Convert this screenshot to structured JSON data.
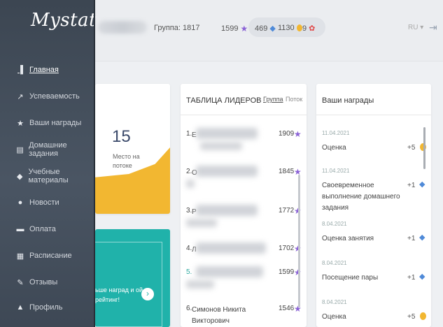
{
  "app": {
    "logo": "Mystat",
    "collapse_glyph": "‹"
  },
  "header": {
    "group": "Группа: 1817",
    "stars": "1599",
    "gems": "469",
    "coins": "1130",
    "badges": "9",
    "lang": "RU ▾"
  },
  "sidebar": {
    "items": [
      {
        "label": "Главная",
        "icon": "chart-icon",
        "glyph": "▐"
      },
      {
        "label": "Успеваемость",
        "icon": "trend-icon",
        "glyph": "↗"
      },
      {
        "label": "Ваши награды",
        "icon": "star-icon",
        "glyph": "★"
      },
      {
        "label": "Домашние задания",
        "icon": "homework-icon",
        "glyph": "▤"
      },
      {
        "label": "Учебные материалы",
        "icon": "materials-icon",
        "glyph": "◆"
      },
      {
        "label": "Новости",
        "icon": "news-icon",
        "glyph": "●"
      },
      {
        "label": "Оплата",
        "icon": "payment-icon",
        "glyph": "▬"
      },
      {
        "label": "Расписание",
        "icon": "calendar-icon",
        "glyph": "▦"
      },
      {
        "label": "Отзывы",
        "icon": "review-icon",
        "glyph": "✎"
      },
      {
        "label": "Профиль",
        "icon": "user-icon",
        "glyph": "▲"
      }
    ]
  },
  "rank": {
    "value": "15",
    "text": "Место на потоке"
  },
  "promo": {
    "text": "ьше наград и ой рейтинг!",
    "arrow": "›"
  },
  "leaders": {
    "title": "ТАБЛИЦА ЛИДЕРОВ",
    "tab_group": "Группа",
    "tab_stream": "Поток",
    "rows": [
      {
        "pos": "1.",
        "name": "Е",
        "points": "1909"
      },
      {
        "pos": "2.",
        "name": "О",
        "points": "1845"
      },
      {
        "pos": "3.",
        "name": "Р",
        "points": "1772"
      },
      {
        "pos": "4.",
        "name": "Л",
        "points": "1702"
      },
      {
        "pos": "5.",
        "name": "",
        "points": "1599"
      },
      {
        "pos": "6.",
        "name": "Симонов Никита Викторович",
        "points": "1546"
      }
    ]
  },
  "awards": {
    "title": "Ваши награды",
    "items": [
      {
        "date": "11.04.2021",
        "label": "Оценка",
        "amount": "+5",
        "type": "coin"
      },
      {
        "date": "11.04.2021",
        "label": "Своевременное выполнение домашнего задания",
        "amount": "+1",
        "type": "gem"
      },
      {
        "date": "8.04.2021",
        "label": "Оценка занятия",
        "amount": "+1",
        "type": "gem"
      },
      {
        "date": "8.04.2021",
        "label": "Посещение пары",
        "amount": "+1",
        "type": "gem"
      },
      {
        "date": "8.04.2021",
        "label": "Оценка",
        "amount": "+5",
        "type": "coin"
      }
    ]
  },
  "colors": {
    "sidebar": "#4a5563",
    "accent_yellow": "#f2b731",
    "accent_teal": "#20b2aa",
    "star": "#8b63d6"
  }
}
